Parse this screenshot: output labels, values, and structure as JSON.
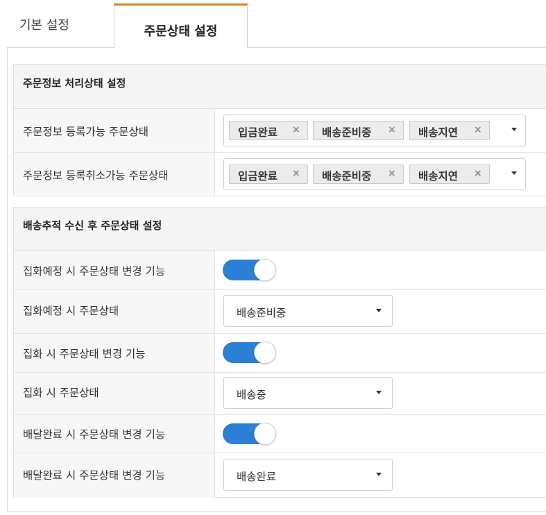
{
  "tabs": {
    "basic": "기본 설정",
    "order_status": "주문상태 설정"
  },
  "section1": {
    "title": "주문정보 처리상태 설정",
    "rows": [
      {
        "label": "주문정보 등록가능 주문상태",
        "chips": [
          "입금완료",
          "배송준비중",
          "배송지연"
        ]
      },
      {
        "label": "주문정보 등록취소가능 주문상태",
        "chips": [
          "입금완료",
          "배송준비중",
          "배송지연"
        ]
      }
    ]
  },
  "section2": {
    "title": "배송추적 수신 후 주문상태 설정",
    "rows": [
      {
        "label": "집화예정 시 주문상태 변경 기능",
        "toggle": true
      },
      {
        "label": "집화예정 시 주문상태",
        "value": "배송준비중"
      },
      {
        "label": "집화 시 주문상태 변경 기능",
        "toggle": true
      },
      {
        "label": "집화 시 주문상태",
        "value": "배송중"
      },
      {
        "label": "배달완료 시 주문상태 변경 기능",
        "toggle": true
      },
      {
        "label": "배달완료 시 주문상태 변경 기능",
        "value": "배송완료"
      }
    ]
  },
  "icons": {
    "chip_remove": "×",
    "dropdown": "caret-down-icon"
  },
  "colors": {
    "tab_accent": "#e07b22",
    "toggle_on": "#2b7fd4"
  }
}
